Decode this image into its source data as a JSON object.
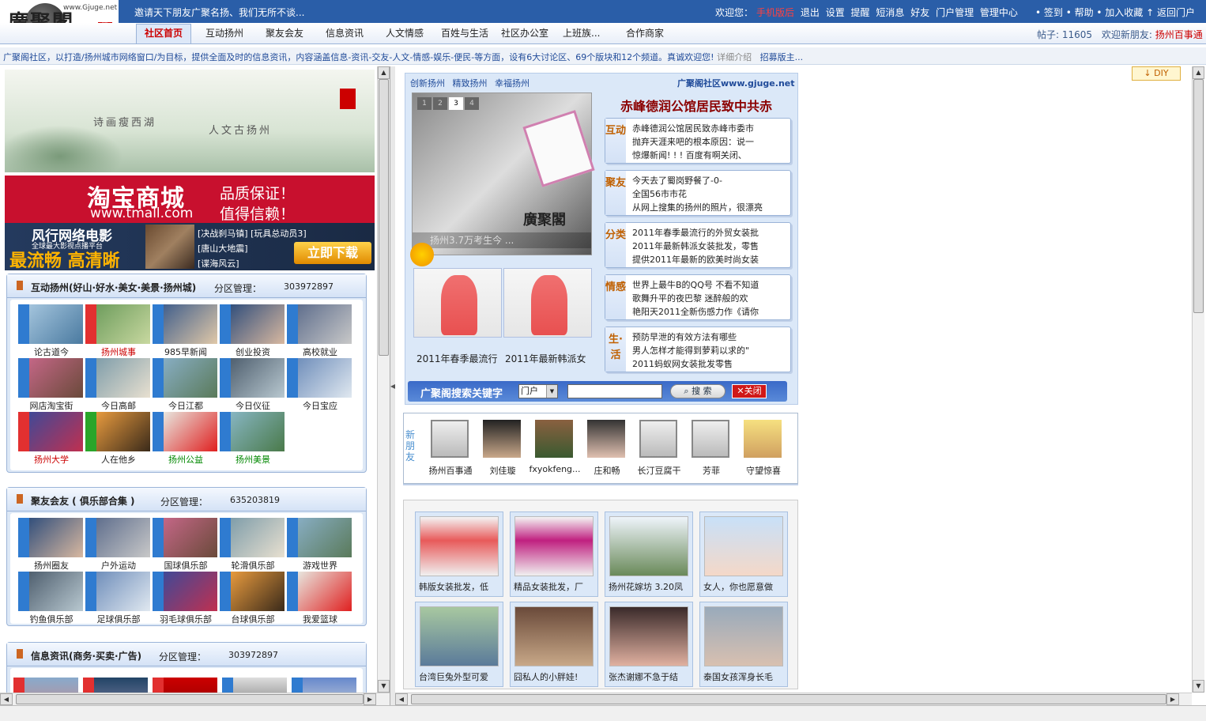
{
  "topbar": {
    "marquee": "邀请天下朋友广聚名扬、我们无所不谈...",
    "welcome": "欢迎您：",
    "username": "手机版后",
    "links": [
      "退出",
      "设置",
      "提醒",
      "短消息",
      "好友",
      "门户管理",
      "管理中心"
    ],
    "right_links": "• 签到 • 帮助 • 加入收藏 ↑ 返回门户"
  },
  "logo": {
    "name": "廣聚閣",
    "url": "www.Gjuge.net",
    "seal": "扬州"
  },
  "nav": {
    "items": [
      "社区首页",
      "互动扬州",
      "聚友会友",
      "信息资讯",
      "人文情感",
      "百姓与生活",
      "社区办公室",
      "上班族...",
      "合作商家"
    ],
    "stats_label": "帖子: 11605",
    "welcome_label": "欢迎新朋友:",
    "welcome_user": "扬州百事通"
  },
  "ticker": {
    "text": "广聚阁社区，以打造/扬州城市网络窗口/为目标，提供全面及时的信息资讯，内容涵盖信息-资讯-交友-人文-情感-娱乐-便民-等方面，设有6大讨论区、69个版块和12个频道。真诚欢迎您!",
    "more": "详细介绍",
    "recruit": "招募版主..."
  },
  "banners": {
    "poem1": "诗画瘦西湖",
    "poem2": "人文古扬州",
    "tmall_big": "淘宝商城",
    "tmall_url": "www.tmall.com",
    "tmall_q1": "品质保证！",
    "tmall_q2": "值得信赖！",
    "movie_title": "风行网络电影",
    "movie_sub": "全球最大影视点播平台",
    "movie_slogan": "最流畅 高清晰",
    "films": [
      "[决战刹马镇] [玩具总动员3]",
      "[唐山大地震]",
      "[谍海风云]"
    ],
    "download": "立即下载"
  },
  "sections": [
    {
      "title": "互动扬州(好山·好水·美女·美景·扬州城)",
      "mgr": "分区管理：",
      "qq": "303972897",
      "forums": [
        {
          "label": "论古道今",
          "tag": "blue",
          "style": ""
        },
        {
          "label": "扬州城事",
          "tag": "red",
          "style": "red"
        },
        {
          "label": "985早新闻",
          "tag": "blue",
          "style": ""
        },
        {
          "label": "创业投资",
          "tag": "blue",
          "style": ""
        },
        {
          "label": "高校就业",
          "tag": "blue",
          "style": ""
        },
        {
          "label": "网店淘宝街",
          "tag": "blue",
          "style": ""
        },
        {
          "label": "今日高邮",
          "tag": "blue",
          "style": ""
        },
        {
          "label": "今日江都",
          "tag": "blue",
          "style": ""
        },
        {
          "label": "今日仪征",
          "tag": "blue",
          "style": ""
        },
        {
          "label": "今日宝应",
          "tag": "blue",
          "style": ""
        },
        {
          "label": "扬州大学",
          "tag": "red",
          "style": "red"
        },
        {
          "label": "人在他乡",
          "tag": "green",
          "style": ""
        },
        {
          "label": "扬州公益",
          "tag": "blue",
          "style": "grn"
        },
        {
          "label": "扬州美景",
          "tag": "blue",
          "style": "grn"
        }
      ]
    },
    {
      "title": "聚友会友 ( 俱乐部合集 )",
      "mgr": "分区管理：",
      "qq": "635203819",
      "forums": [
        {
          "label": "扬州圈友",
          "tag": "blue",
          "style": ""
        },
        {
          "label": "户外运动",
          "tag": "blue",
          "style": ""
        },
        {
          "label": "国球俱乐部",
          "tag": "blue",
          "style": ""
        },
        {
          "label": "轮滑俱乐部",
          "tag": "blue",
          "style": ""
        },
        {
          "label": "游戏世界",
          "tag": "blue",
          "style": ""
        },
        {
          "label": "钓鱼俱乐部",
          "tag": "blue",
          "style": ""
        },
        {
          "label": "足球俱乐部",
          "tag": "blue",
          "style": ""
        },
        {
          "label": "羽毛球俱乐部",
          "tag": "blue",
          "style": ""
        },
        {
          "label": "台球俱乐部",
          "tag": "blue",
          "style": ""
        },
        {
          "label": "我爱篮球",
          "tag": "blue",
          "style": ""
        }
      ]
    },
    {
      "title": "信息资讯(商务·买卖·广告)",
      "mgr": "分区管理：",
      "qq": "303972897",
      "forums": []
    }
  ],
  "portal": {
    "tabs": [
      "创新扬州",
      "精致扬州",
      "幸福扬州"
    ],
    "site": "广聚阁社区www.gjuge.net",
    "slider_nums": [
      "1",
      "2",
      "3",
      "4"
    ],
    "slider_caption": "扬州3.7万考生今 ...",
    "slider_watermark": "廣聚閣",
    "dress_labels": [
      "2011年春季最流行",
      "2011年最新韩派女"
    ],
    "headline": "赤峰德润公馆居民致中共赤",
    "news": [
      {
        "cat": "互动",
        "lines": [
          "赤峰德润公馆居民致赤峰市委市",
          "抛弃天涯来吧的根本原因：说一",
          "惊爆新闻! ! ! 百度有啊关闭、"
        ]
      },
      {
        "cat": "聚友",
        "lines": [
          "今天去了蜀岗野餐了-0-",
          "全国56市市花",
          "从网上搜集的扬州的照片，很漂亮"
        ]
      },
      {
        "cat": "分类",
        "lines": [
          "2011年春季最流行的外贸女装批",
          "2011年最新韩派女装批发，零售",
          "提供2011年最新的欧美时尚女装"
        ]
      },
      {
        "cat": "情感",
        "lines": [
          "世界上最牛B的QQ号 不看不知道",
          "歌舞升平的夜巴黎 迷醉般的欢",
          "艳阳天2011全新伤感力作《请你"
        ]
      },
      {
        "cat": "生·活",
        "lines": [
          "预防早泄的有效方法有哪些",
          "男人怎样才能得到萝莉以求的\"",
          "2011蚂蚁网女装批发零售"
        ]
      }
    ],
    "search_label": "广聚阁搜索关键字",
    "search_select": "门户",
    "search_placeholder": "",
    "search_btn": "搜 索",
    "close_btn": "关闭"
  },
  "diy": "↓ DIY",
  "newfriends": {
    "side": "新朋友",
    "friends": [
      "扬州百事通",
      "刘佳璇",
      "fxyokfeng...",
      "庄和畅",
      "长汀豆腐干",
      "芳菲",
      "守望惊喜"
    ]
  },
  "gallery": [
    "韩版女装批发，低",
    "精品女装批发，厂",
    "扬州花嫁坊 3.20凤",
    "女人，你也愿意做",
    "台湾巨兔外型可爱",
    "囧私人的小胖娃!",
    "张杰谢娜不急于结",
    "泰国女孩浑身长毛"
  ]
}
